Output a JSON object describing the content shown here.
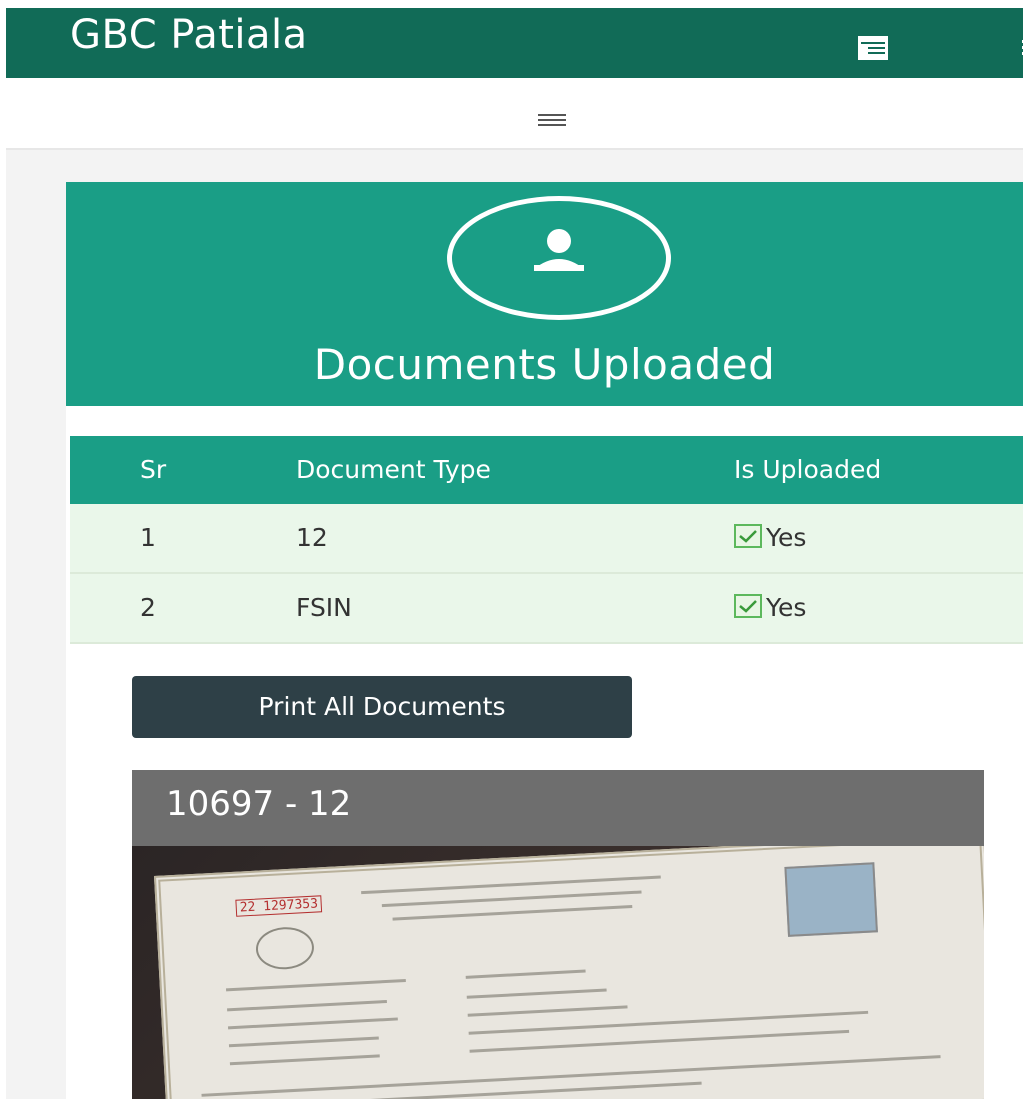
{
  "header": {
    "brand": "GBC Patiala",
    "icons": [
      "list-icon",
      "menu-icon"
    ]
  },
  "toggle": {
    "icon": "hamburger-icon"
  },
  "card": {
    "icon": "user-avatar-icon",
    "title": "Documents Uploaded"
  },
  "table": {
    "columns": [
      "Sr",
      "Document Type",
      "Is Uploaded"
    ],
    "rows": [
      {
        "sr": "1",
        "type": "12",
        "uploaded": "Yes"
      },
      {
        "sr": "2",
        "type": "FSIN",
        "uploaded": "Yes"
      }
    ]
  },
  "actions": {
    "print_label": "Print All Documents"
  },
  "preview": {
    "title": "10697 - 12",
    "serial": "22 1297353"
  },
  "colors": {
    "topbar": "#116b57",
    "accent": "#1a9e86",
    "row_bg": "#eaf7ea",
    "button": "#2e4047",
    "check": "#5cb85c"
  }
}
